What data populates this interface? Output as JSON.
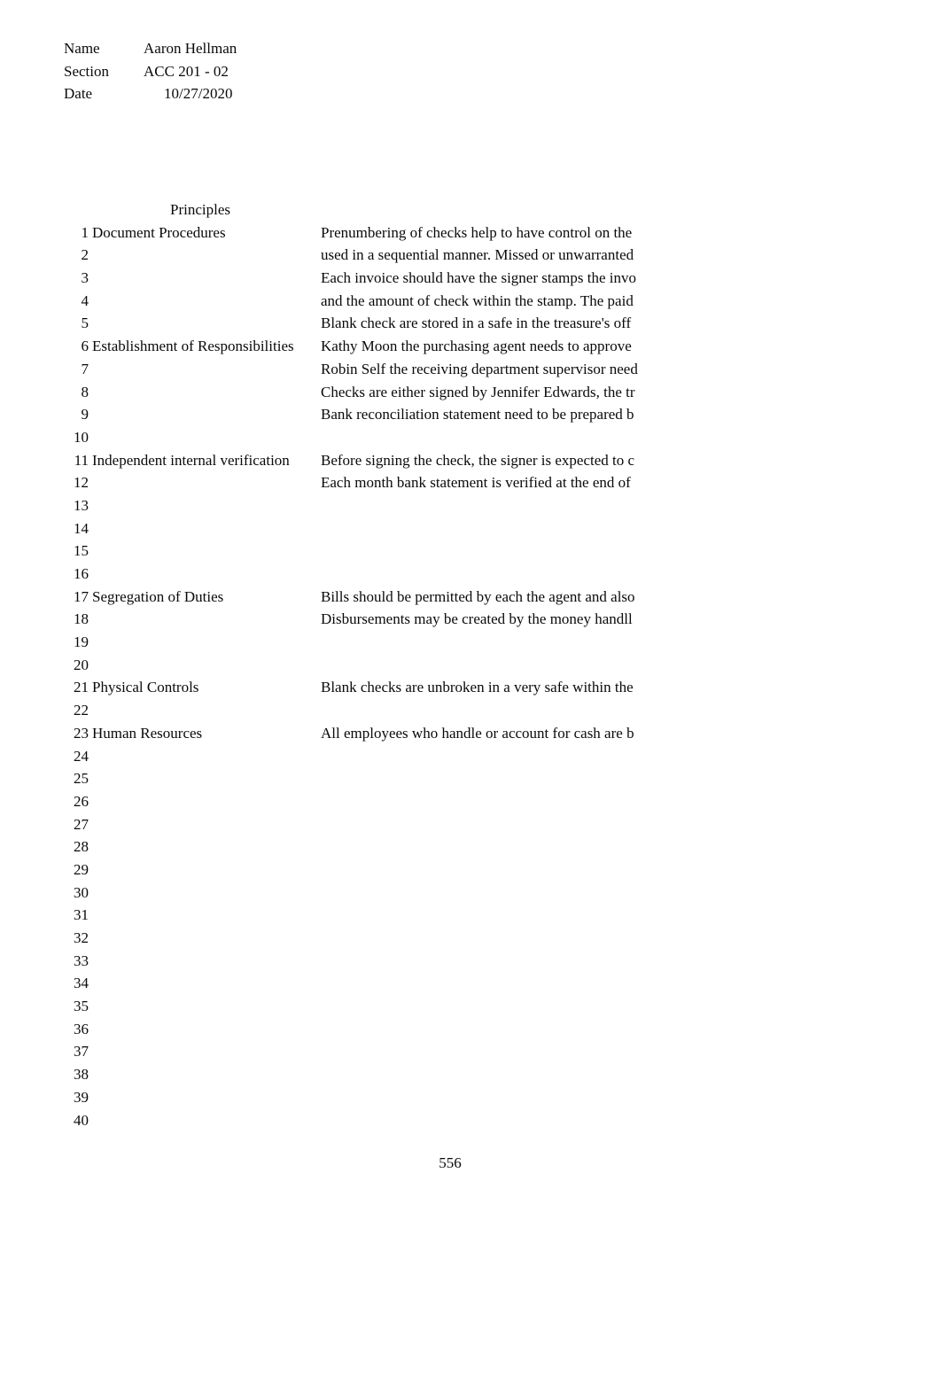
{
  "header": {
    "name_label": "Name",
    "name_value": "Aaron Hellman",
    "section_label": "Section",
    "section_value": "ACC 201 - 02",
    "date_label": "Date",
    "date_value": "10/27/2020"
  },
  "sheet": {
    "column_header": "Principles",
    "rows": [
      {
        "num": "1",
        "principle": "Document Procedures",
        "desc": "Prenumbering of checks help to have control on the"
      },
      {
        "num": "2",
        "principle": "",
        "desc": "used in a sequential manner. Missed or unwarranted"
      },
      {
        "num": "3",
        "principle": "",
        "desc": "Each invoice should have the signer stamps the invo"
      },
      {
        "num": "4",
        "principle": "",
        "desc": "and the amount of check within the stamp. The paid"
      },
      {
        "num": "5",
        "principle": "",
        "desc": "Blank check are stored in a safe in the treasure's off"
      },
      {
        "num": "6",
        "principle": "Establishment of Responsibilities",
        "desc": "Kathy Moon the purchasing agent needs to approve"
      },
      {
        "num": "7",
        "principle": "",
        "desc": "Robin Self the receiving department supervisor need"
      },
      {
        "num": "8",
        "principle": "",
        "desc": "Checks are either signed by Jennifer Edwards, the tr"
      },
      {
        "num": "9",
        "principle": "",
        "desc": "Bank reconciliation statement need to be prepared b"
      },
      {
        "num": "10",
        "principle": "",
        "desc": ""
      },
      {
        "num": "11",
        "principle": "Independent internal verification",
        "desc": "Before signing the check, the signer is expected to c"
      },
      {
        "num": "12",
        "principle": "",
        "desc": "Each month bank statement is verified at the end of"
      },
      {
        "num": "13",
        "principle": "",
        "desc": ""
      },
      {
        "num": "14",
        "principle": "",
        "desc": ""
      },
      {
        "num": "15",
        "principle": "",
        "desc": ""
      },
      {
        "num": "16",
        "principle": "",
        "desc": ""
      },
      {
        "num": "17",
        "principle": "Segregation of Duties",
        "desc": "Bills should be permitted by each the agent and also"
      },
      {
        "num": "18",
        "principle": "",
        "desc": "Disbursements may be created by the money handll"
      },
      {
        "num": "19",
        "principle": "",
        "desc": ""
      },
      {
        "num": "20",
        "principle": "",
        "desc": ""
      },
      {
        "num": "21",
        "principle": "Physical Controls",
        "desc": "Blank checks are unbroken in a very safe within the"
      },
      {
        "num": "22",
        "principle": "",
        "desc": ""
      },
      {
        "num": "23",
        "principle": "Human Resources",
        "desc": "All employees who handle or account for cash are b"
      },
      {
        "num": "24",
        "principle": "",
        "desc": ""
      },
      {
        "num": "25",
        "principle": "",
        "desc": ""
      },
      {
        "num": "26",
        "principle": "",
        "desc": ""
      },
      {
        "num": "27",
        "principle": "",
        "desc": ""
      },
      {
        "num": "28",
        "principle": "",
        "desc": ""
      },
      {
        "num": "29",
        "principle": "",
        "desc": ""
      },
      {
        "num": "30",
        "principle": "",
        "desc": ""
      },
      {
        "num": "31",
        "principle": "",
        "desc": ""
      },
      {
        "num": "32",
        "principle": "",
        "desc": ""
      },
      {
        "num": "33",
        "principle": "",
        "desc": ""
      },
      {
        "num": "34",
        "principle": "",
        "desc": ""
      },
      {
        "num": "35",
        "principle": "",
        "desc": ""
      },
      {
        "num": "36",
        "principle": "",
        "desc": ""
      },
      {
        "num": "37",
        "principle": "",
        "desc": ""
      },
      {
        "num": "38",
        "principle": "",
        "desc": ""
      },
      {
        "num": "39",
        "principle": "",
        "desc": ""
      },
      {
        "num": "40",
        "principle": "",
        "desc": ""
      }
    ]
  },
  "footer": {
    "page_number": "556"
  }
}
